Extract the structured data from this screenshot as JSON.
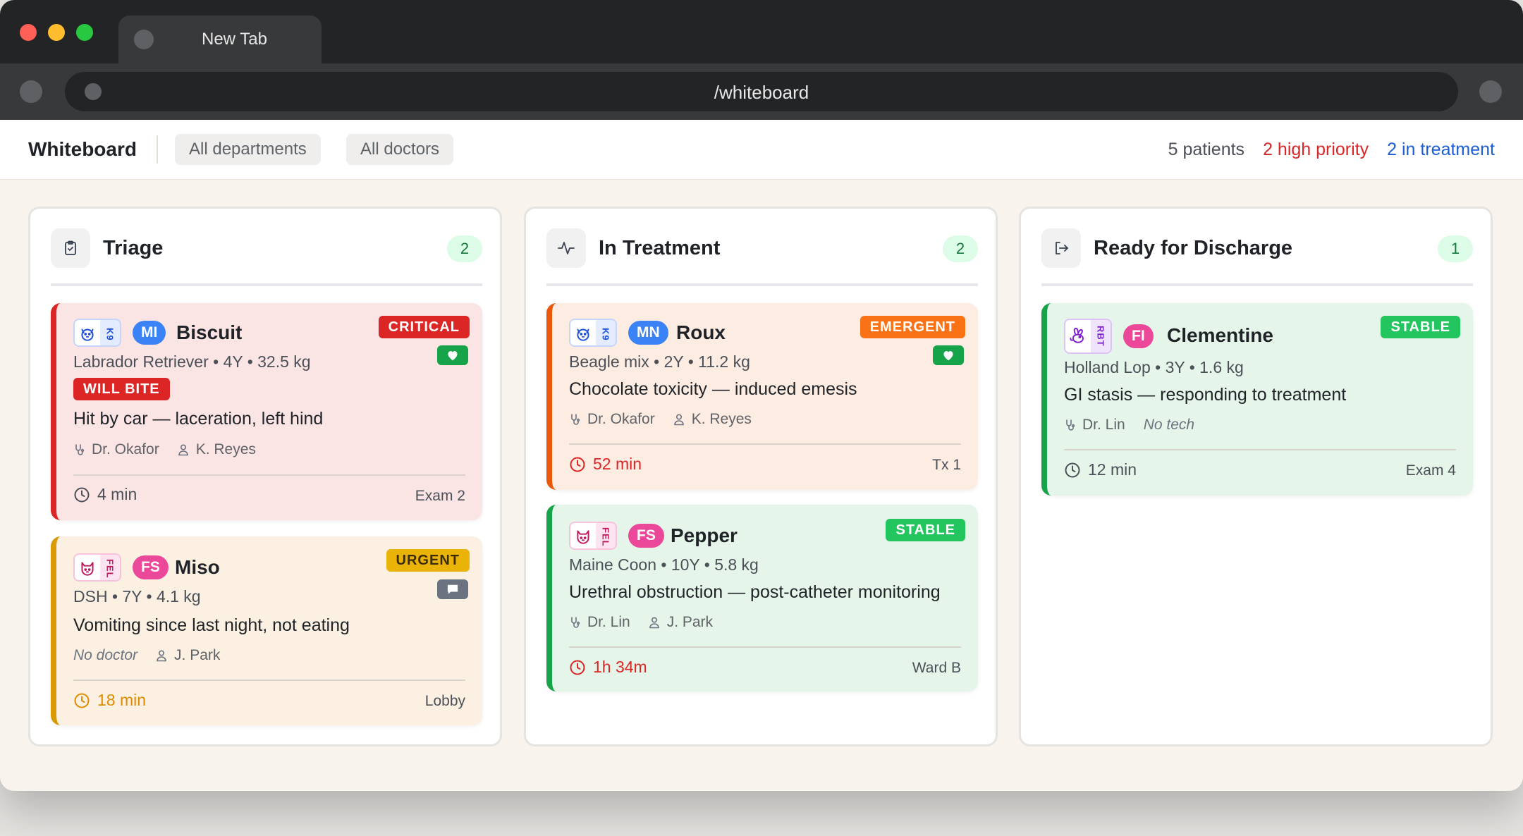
{
  "browser": {
    "tab_title": "New Tab",
    "url": "/whiteboard"
  },
  "header": {
    "title": "Whiteboard",
    "filter_department": "All departments",
    "filter_doctor": "All doctors",
    "stats": {
      "patients": "5 patients",
      "high_priority": "2 high priority",
      "in_treatment": "2 in treatment"
    }
  },
  "colors": {
    "critical": "#dc2626",
    "urgent": "#eab308",
    "emergent": "#f97316",
    "stable": "#22c55e",
    "accent_blue": "#1c5ed6"
  },
  "columns": [
    {
      "title": "Triage",
      "icon": "clipboard-check-icon",
      "count": "2",
      "cards": [
        {
          "species_code": "K9",
          "species_icon": "dog-icon",
          "initials": "MI",
          "name": "Biscuit",
          "priority": "CRITICAL",
          "badge_icon": "heart-icon",
          "breed": "Labrador Retriever • 4Y • 32.5 kg",
          "warning": "WILL BITE",
          "complaint": "Hit by car — laceration, left hind",
          "doctor": "Dr. Okafor",
          "tech": "K. Reyes",
          "elapsed": "4 min",
          "location": "Exam 2"
        },
        {
          "species_code": "FEL",
          "species_icon": "cat-icon",
          "initials": "FS",
          "name": "Miso",
          "priority": "URGENT",
          "badge_icon": "message-icon",
          "breed": "DSH • 7Y • 4.1 kg",
          "complaint": "Vomiting since last night, not eating",
          "doctor": "No doctor",
          "tech": "J. Park",
          "elapsed": "18 min",
          "location": "Lobby"
        }
      ]
    },
    {
      "title": "In Treatment",
      "icon": "activity-icon",
      "count": "2",
      "cards": [
        {
          "species_code": "K9",
          "species_icon": "dog-icon",
          "initials": "MN",
          "name": "Roux",
          "priority": "EMERGENT",
          "badge_icon": "heart-icon",
          "breed": "Beagle mix • 2Y • 11.2 kg",
          "complaint": "Chocolate toxicity — induced emesis",
          "doctor": "Dr. Okafor",
          "tech": "K. Reyes",
          "elapsed": "52 min",
          "location": "Tx 1"
        },
        {
          "species_code": "FEL",
          "species_icon": "cat-icon",
          "initials": "FS",
          "name": "Pepper",
          "priority": "STABLE",
          "breed": "Maine Coon • 10Y • 5.8 kg",
          "complaint": "Urethral obstruction — post-catheter monitoring",
          "doctor": "Dr. Lin",
          "tech": "J. Park",
          "elapsed": "1h 34m",
          "location": "Ward B"
        }
      ]
    },
    {
      "title": "Ready for Discharge",
      "icon": "log-out-icon",
      "count": "1",
      "cards": [
        {
          "species_code": "RBT",
          "species_icon": "rabbit-icon",
          "initials": "FI",
          "name": "Clementine",
          "priority": "STABLE",
          "breed": "Holland Lop • 3Y • 1.6 kg",
          "complaint": "GI stasis — responding to treatment",
          "doctor": "Dr. Lin",
          "tech": "No tech",
          "elapsed": "12 min",
          "location": "Exam 4"
        }
      ]
    }
  ]
}
